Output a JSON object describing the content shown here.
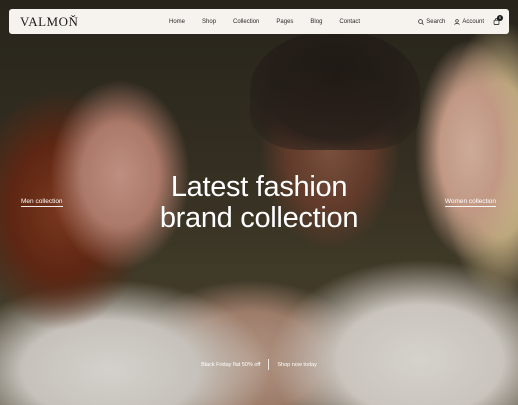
{
  "header": {
    "logo": "VALMOŇ",
    "nav": [
      "Home",
      "Shop",
      "Collection",
      "Pages",
      "Blog",
      "Contact"
    ],
    "search_label": "Search",
    "account_label": "Account",
    "cart_count": "0",
    "icons": {
      "search": "search-icon",
      "account": "user-icon",
      "cart": "shopping-bag-icon"
    }
  },
  "hero": {
    "headline_line1": "Latest fashion",
    "headline_line2": "brand collection",
    "left_link": "Men collection",
    "right_link": "Women collection",
    "promo_text": "Black Friday flat 50% off",
    "promo_link": "Shop now today"
  },
  "colors": {
    "header_bg": "#f6f3ef",
    "text_dark": "#1a1a1a",
    "hero_text": "#ffffff"
  }
}
